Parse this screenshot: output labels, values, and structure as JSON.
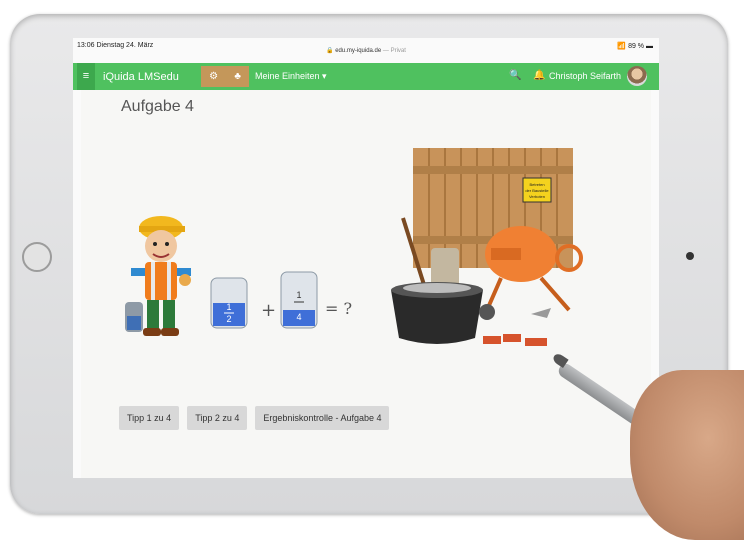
{
  "status": {
    "time": "13:06",
    "date": "Dienstag 24. März",
    "url": "edu.my-iquida.de",
    "private_label": "— Privat",
    "battery": "89 %"
  },
  "nav": {
    "menu_icon": "≡",
    "brand": "iQuida LMSedu",
    "units_label": "Meine Einheiten ▾",
    "user_name": "Christoph Seifarth"
  },
  "page": {
    "title": "Aufgabe 4"
  },
  "equation": {
    "frac1_num": "1",
    "frac1_den": "2",
    "plus": "+",
    "frac2_num": "1",
    "frac2_den": "4",
    "equals": "= ?"
  },
  "sign": {
    "line1": "Betreten",
    "line2": "der Baustelle",
    "line3": "Verboten"
  },
  "buttons": {
    "tip1": "Tipp 1 zu 4",
    "tip2": "Tipp 2 zu 4",
    "check": "Ergebniskontrolle - Aufgabe 4"
  },
  "colors": {
    "navbar": "#4fc15f",
    "accent": "#c4975a",
    "button_bg": "#d8d8d8"
  }
}
